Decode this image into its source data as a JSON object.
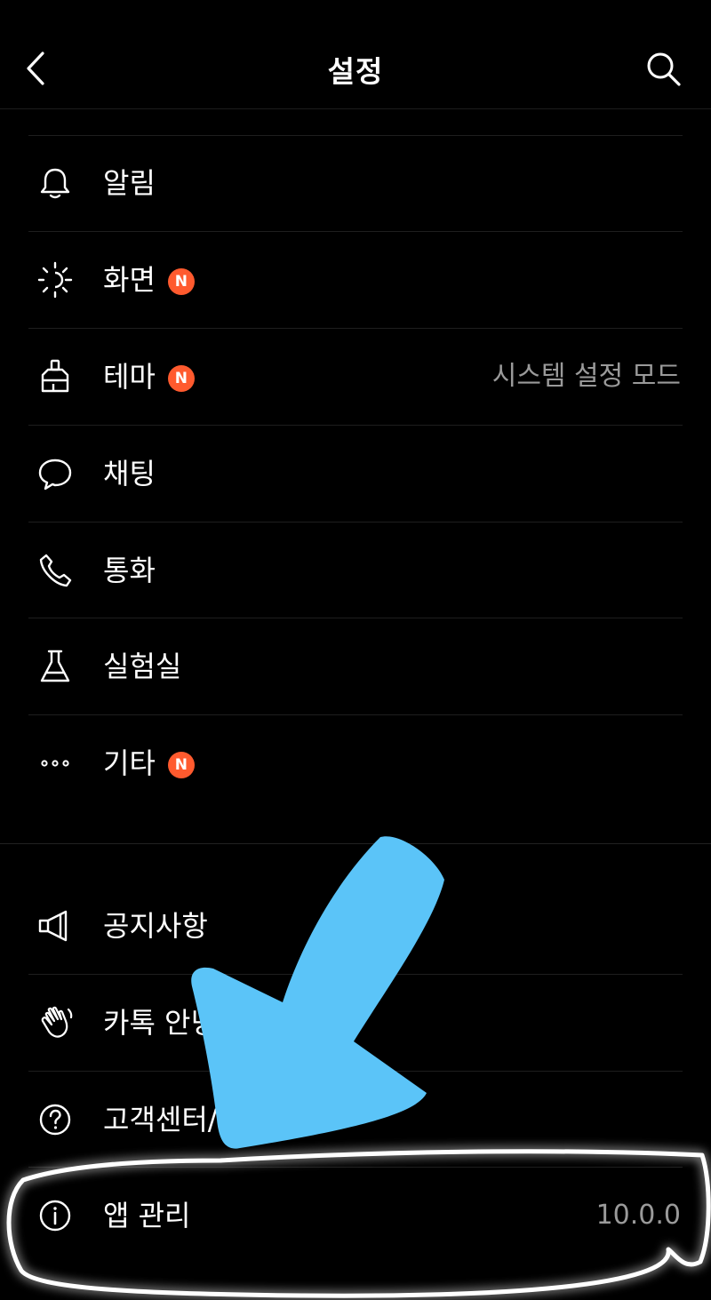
{
  "header": {
    "title": "설정",
    "back_icon": "chevron-left-icon",
    "search_icon": "search-icon"
  },
  "menu": [
    {
      "label": "알림",
      "icon": "bell-icon",
      "badge": "",
      "value": ""
    },
    {
      "label": "화면",
      "icon": "brightness-icon",
      "badge": "N",
      "value": ""
    },
    {
      "label": "테마",
      "icon": "paint-brush-icon",
      "badge": "N",
      "value": "시스템 설정 모드"
    },
    {
      "label": "채팅",
      "icon": "chat-bubble-icon",
      "badge": "",
      "value": ""
    },
    {
      "label": "통화",
      "icon": "phone-icon",
      "badge": "",
      "value": ""
    },
    {
      "label": "실험실",
      "icon": "flask-icon",
      "badge": "",
      "value": ""
    },
    {
      "label": "기타",
      "icon": "more-dots-icon",
      "badge": "N",
      "value": ""
    }
  ],
  "support": [
    {
      "label": "공지사항",
      "icon": "megaphone-icon",
      "value": ""
    },
    {
      "label": "카톡 안녕",
      "icon": "waving-hand-icon",
      "value": ""
    },
    {
      "label": "고객센터/",
      "icon": "help-circle-icon",
      "value": ""
    },
    {
      "label": "앱 관리",
      "icon": "info-circle-icon",
      "value": "10.0.0"
    }
  ],
  "colors": {
    "background": "#000000",
    "badge": "#ff5a2e",
    "secondary_text": "#9a9a9a",
    "annotation_arrow": "#5bc4f8"
  }
}
